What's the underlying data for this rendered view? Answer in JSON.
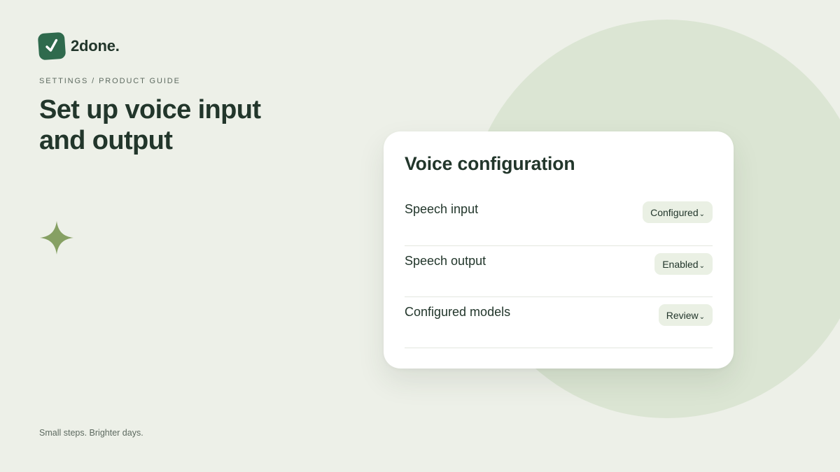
{
  "brand": {
    "name": "2done.",
    "icon": "checkmark-icon",
    "accent": "#2f6a4d"
  },
  "breadcrumb": "SETTINGS / PRODUCT GUIDE",
  "title_lines": [
    "Set up voice input",
    "and output"
  ],
  "decor": {
    "icon": "sparkle-icon",
    "color": "#86a063"
  },
  "tagline": "Small steps. Brighter days.",
  "card": {
    "title": "Voice configuration",
    "rows": [
      {
        "label": "Speech input",
        "value": "Configured",
        "icon": "chevron-down-icon"
      },
      {
        "label": "Speech output",
        "value": "Enabled",
        "icon": "chevron-down-icon"
      },
      {
        "label": "Configured models",
        "value": "Review",
        "icon": "chevron-down-icon"
      }
    ]
  },
  "colors": {
    "background": "#edf0e8",
    "circle": "#dbe5d3",
    "pill": "#eaf0e4",
    "text": "#22362b"
  }
}
